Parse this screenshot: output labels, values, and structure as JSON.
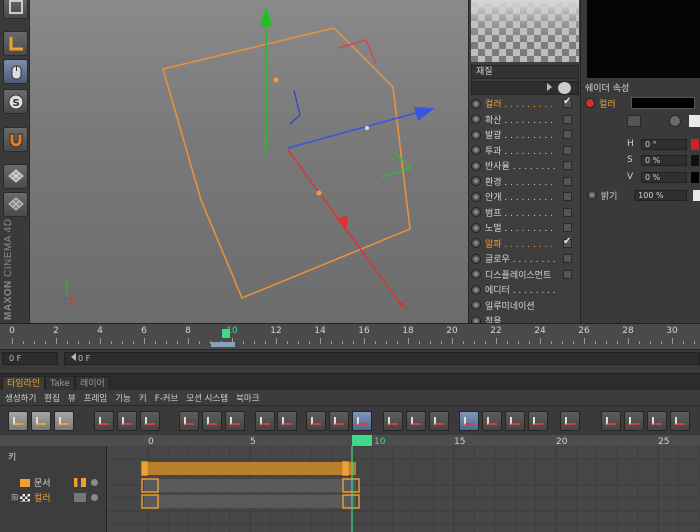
{
  "brand": {
    "line1": "MAXON",
    "line2": "CINEMA 4D"
  },
  "material_panel": {
    "name_label": "재질",
    "channels": [
      {
        "label": "컬러 . . . . . . . . .",
        "checked": true,
        "active": true
      },
      {
        "label": "확산 . . . . . . . . .",
        "checked": false,
        "active": false
      },
      {
        "label": "발광 . . . . . . . . .",
        "checked": false,
        "active": false
      },
      {
        "label": "투과 . . . . . . . . .",
        "checked": false,
        "active": false
      },
      {
        "label": "반사율 . . . . . . . .",
        "checked": false,
        "active": false
      },
      {
        "label": "환경 . . . . . . . . .",
        "checked": false,
        "active": false
      },
      {
        "label": "안개 . . . . . . . . .",
        "checked": false,
        "active": false
      },
      {
        "label": "범프 . . . . . . . . .",
        "checked": false,
        "active": false
      },
      {
        "label": "노멀 . . . . . . . . .",
        "checked": false,
        "active": false
      },
      {
        "label": "알파 . . . . . . . . .",
        "checked": true,
        "active": true
      },
      {
        "label": "글로우 . . . . . . . .",
        "checked": false,
        "active": false
      },
      {
        "label": "디스플레이스먼트",
        "checked": false,
        "active": false
      },
      {
        "label": "에디터 . . . . . . . .",
        "checked": null,
        "active": false
      },
      {
        "label": "일루미네이션",
        "checked": null,
        "active": false
      },
      {
        "label": "적용 . . . . . . . . .",
        "checked": null,
        "active": false
      }
    ]
  },
  "shader_panel": {
    "title": "쉐이더 속성",
    "color_label": "컬러",
    "h_label": "H",
    "h_value": "0 °",
    "s_label": "S",
    "s_value": "0 %",
    "v_label": "V",
    "v_value": "0 %",
    "brightness_label": "밝기",
    "brightness_value": "100 %",
    "swatch_color": "#000000"
  },
  "ruler": {
    "ticks": [
      "0",
      "2",
      "4",
      "6",
      "8",
      "10",
      "12",
      "14",
      "16",
      "18",
      "20",
      "22",
      "24",
      "26",
      "28",
      "30"
    ],
    "current_frame": "10",
    "start_field": "0 F",
    "end_field": "0 F"
  },
  "timeline": {
    "tabs": [
      "타임라인",
      "Take",
      "레이어"
    ],
    "menu": [
      "생성하기",
      "편집",
      "뷰",
      "프레임",
      "기능",
      "키",
      "F-커브",
      "모션 시스템",
      "북마크"
    ],
    "key_header": "키",
    "frame_ticks": [
      "0",
      "5",
      "10",
      "15",
      "20",
      "25"
    ],
    "current_frame": "10",
    "tracks": [
      {
        "name": "문서",
        "type": "document"
      },
      {
        "name": "컬러",
        "type": "material"
      }
    ]
  },
  "colors": {
    "accent": "#f0a030",
    "playhead": "#3fd98a",
    "object_outline": "#e8913a",
    "axis_x": "#3a54e0",
    "axis_y": "#1ec21e",
    "axis_z": "#e03030"
  }
}
